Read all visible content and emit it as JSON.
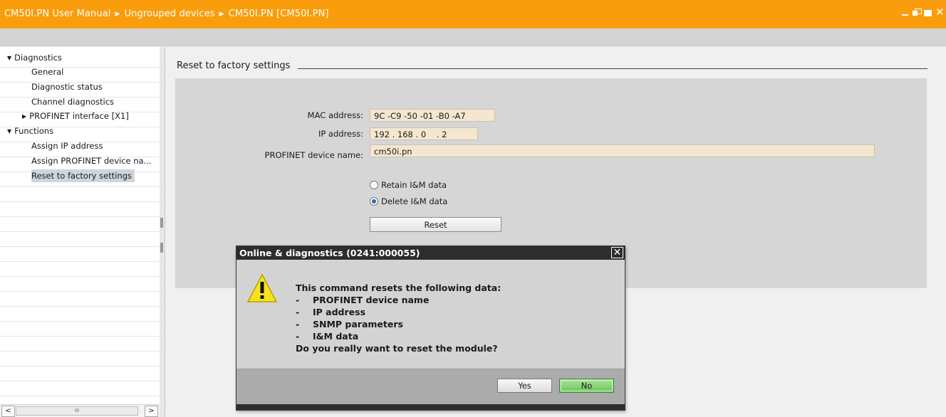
{
  "window": {
    "breadcrumbs": [
      "CM50I.PN User Manual",
      "Ungrouped devices",
      "CM50I.PN [CM50I.PN]"
    ],
    "controls": [
      "minimize-icon",
      "restore-icon",
      "maximize-icon",
      "close-icon"
    ],
    "accent_color": "#f99d0c"
  },
  "nav": {
    "items": [
      {
        "label": "Diagnostics",
        "kind": "group-expanded"
      },
      {
        "label": "General",
        "kind": "item"
      },
      {
        "label": "Diagnostic status",
        "kind": "item"
      },
      {
        "label": "Channel diagnostics",
        "kind": "item"
      },
      {
        "label": "PROFINET interface [X1]",
        "kind": "group-collapsed"
      },
      {
        "label": "Functions",
        "kind": "group-expanded"
      },
      {
        "label": "Assign IP address",
        "kind": "item"
      },
      {
        "label": "Assign PROFINET device na...",
        "kind": "item"
      },
      {
        "label": "Reset to factory settings",
        "kind": "item-selected"
      }
    ],
    "scroll_thumb_glyph": "III"
  },
  "main": {
    "section_title": "Reset to factory settings",
    "mac": {
      "label": "MAC address:",
      "value": "9C -C9 -50 -01 -B0 -A7"
    },
    "ip": {
      "label": "IP address:",
      "value": "192 . 168 . 0    . 2"
    },
    "device_name": {
      "label": "PROFINET device name:",
      "value": "cm50i.pn"
    },
    "radios": [
      {
        "label": "Retain I&M data",
        "checked": false
      },
      {
        "label": "Delete I&M data",
        "checked": true
      }
    ],
    "reset_label": "Reset"
  },
  "dialog": {
    "title": "Online & diagnostics (0241:000055)",
    "intro": "This command resets the following data:",
    "items": [
      "PROFINET device name",
      "IP address",
      "SNMP parameters",
      "I&M data"
    ],
    "bullet": "-",
    "question": "Do you really want to reset the module?",
    "yes_label": "Yes",
    "no_label": "No",
    "icon": "warning-icon"
  }
}
